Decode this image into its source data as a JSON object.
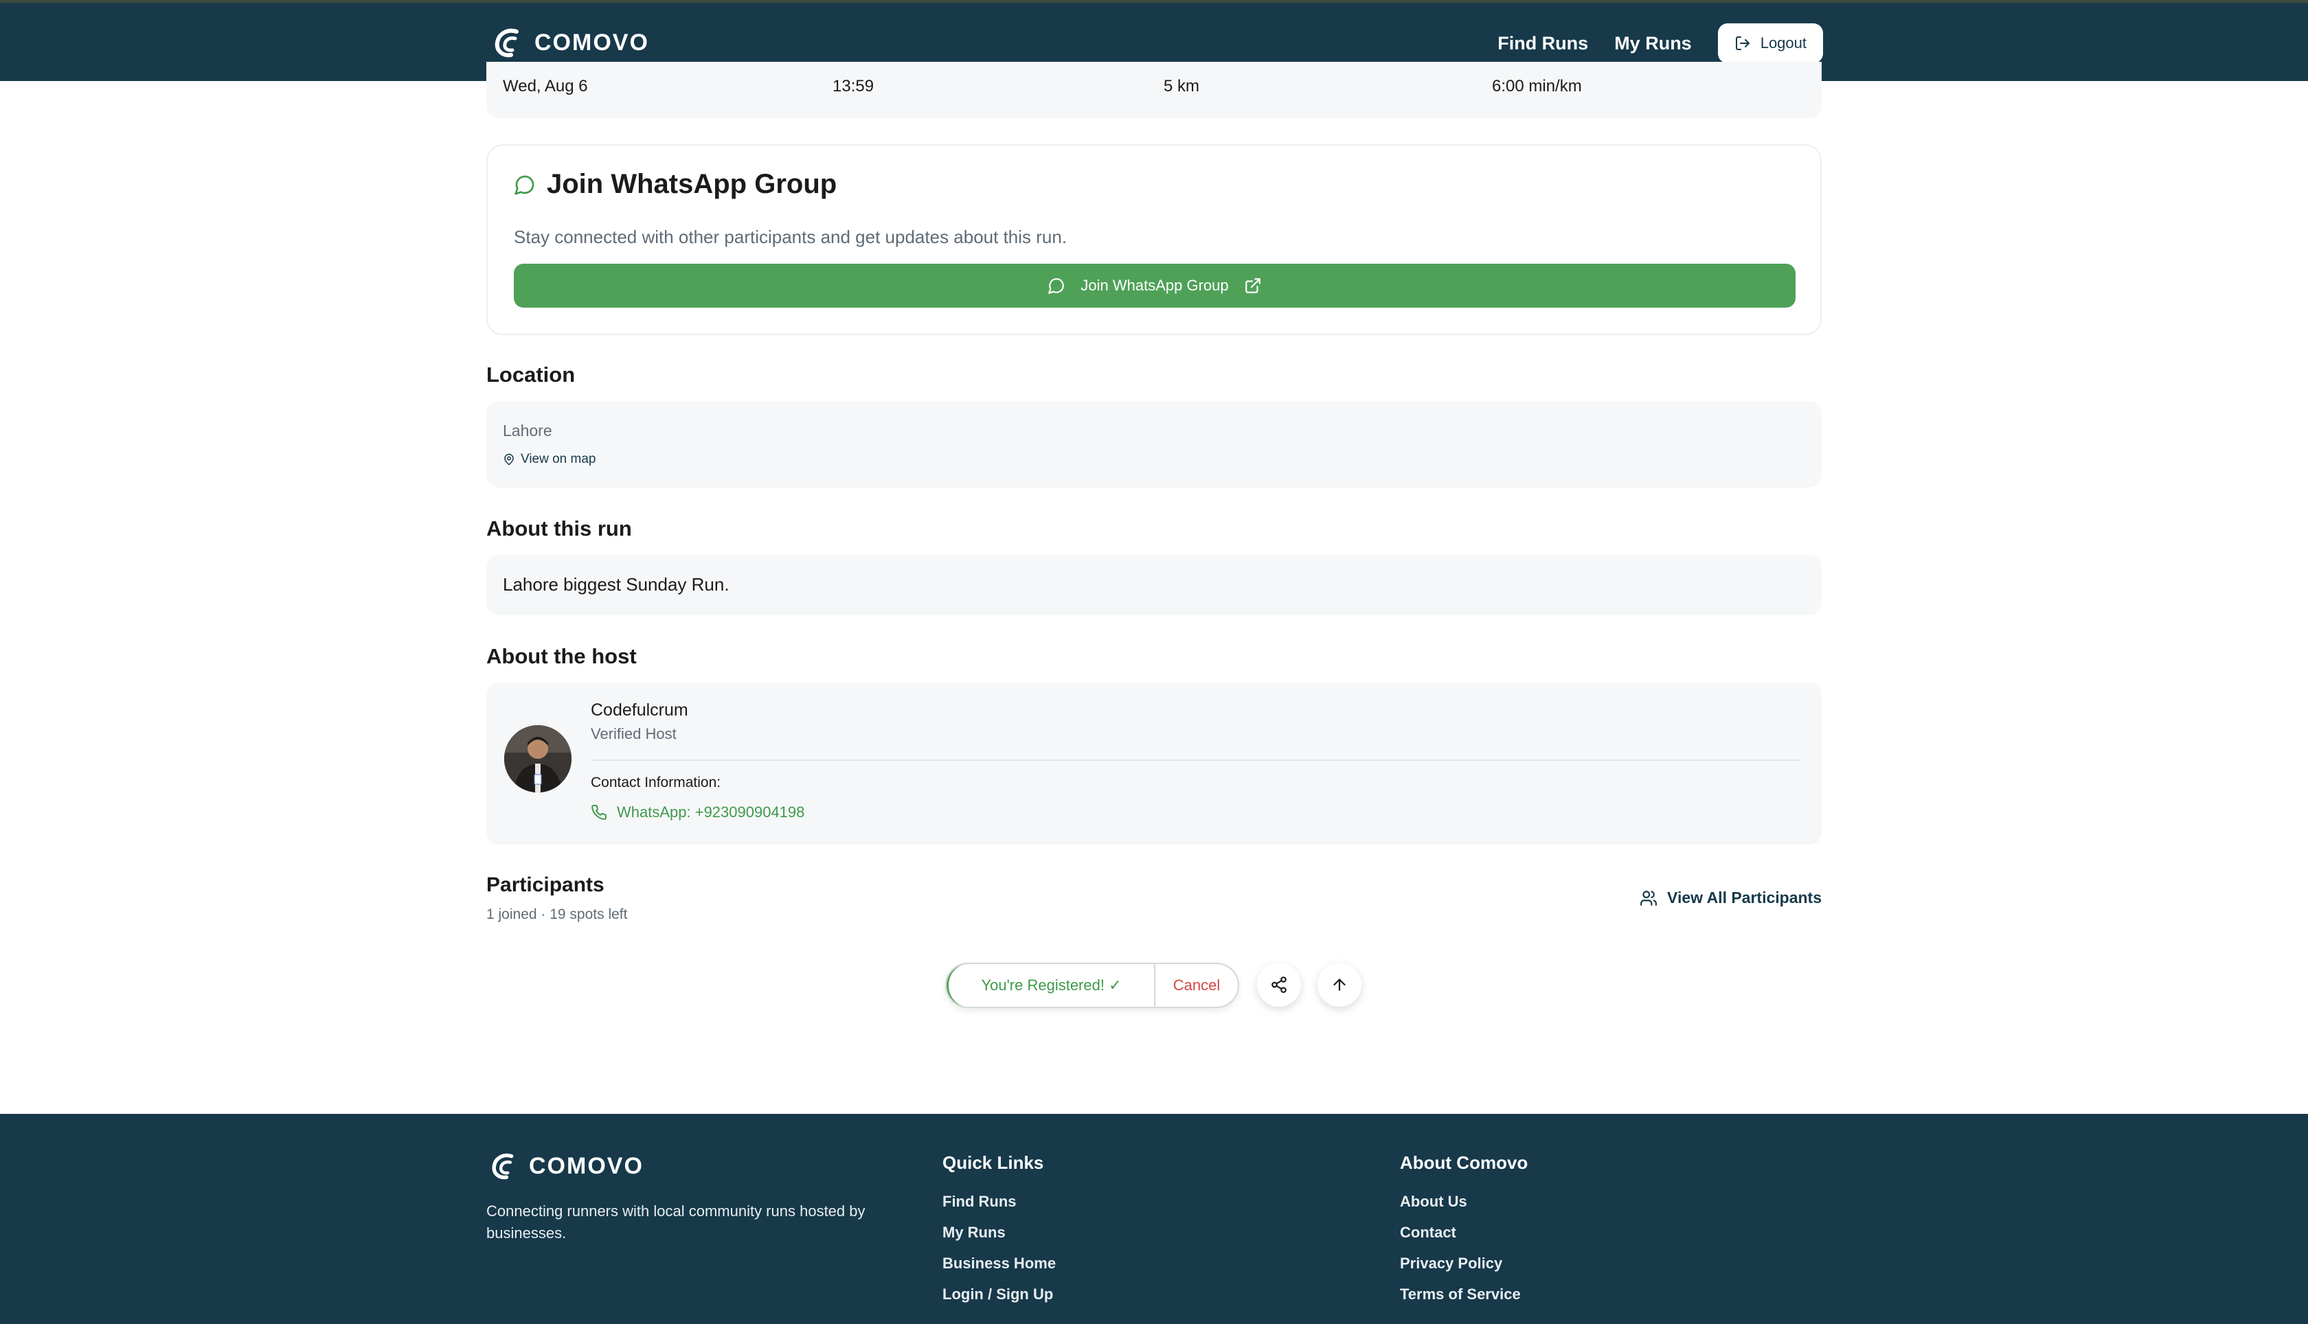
{
  "colors": {
    "navy": "#17394a",
    "whatsapp_green": "#4fa157",
    "cancel_red": "#d64545",
    "panel_bg": "#f6f7f8"
  },
  "header": {
    "brand": "COMOVO",
    "nav": {
      "find_runs": "Find Runs",
      "my_runs": "My Runs",
      "logout": "Logout"
    }
  },
  "stats": {
    "date": "Wed, Aug 6",
    "time": "13:59",
    "distance": "5 km",
    "pace": "6:00 min/km"
  },
  "whatsapp": {
    "title": "Join WhatsApp Group",
    "description": "Stay connected with other participants and get updates about this run.",
    "button_label": "Join WhatsApp Group"
  },
  "location": {
    "heading": "Location",
    "city": "Lahore",
    "map_link": "View on map"
  },
  "about_run": {
    "heading": "About this run",
    "text": "Lahore biggest Sunday Run."
  },
  "host": {
    "heading": "About the host",
    "name": "Codefulcrum",
    "role": "Verified Host",
    "contact_label": "Contact Information:",
    "whatsapp": "WhatsApp: +923090904198"
  },
  "participants": {
    "heading": "Participants",
    "summary": "1 joined · 19 spots left",
    "view_all": "View All Participants"
  },
  "actions": {
    "registered": "You're Registered! ✓",
    "cancel": "Cancel"
  },
  "footer": {
    "brand": "COMOVO",
    "tagline": "Connecting runners with local community runs hosted by businesses.",
    "quick_links": {
      "title": "Quick Links",
      "items": [
        "Find Runs",
        "My Runs",
        "Business Home",
        "Login / Sign Up"
      ]
    },
    "about": {
      "title": "About Comovo",
      "items": [
        "About Us",
        "Contact",
        "Privacy Policy",
        "Terms of Service"
      ]
    }
  }
}
